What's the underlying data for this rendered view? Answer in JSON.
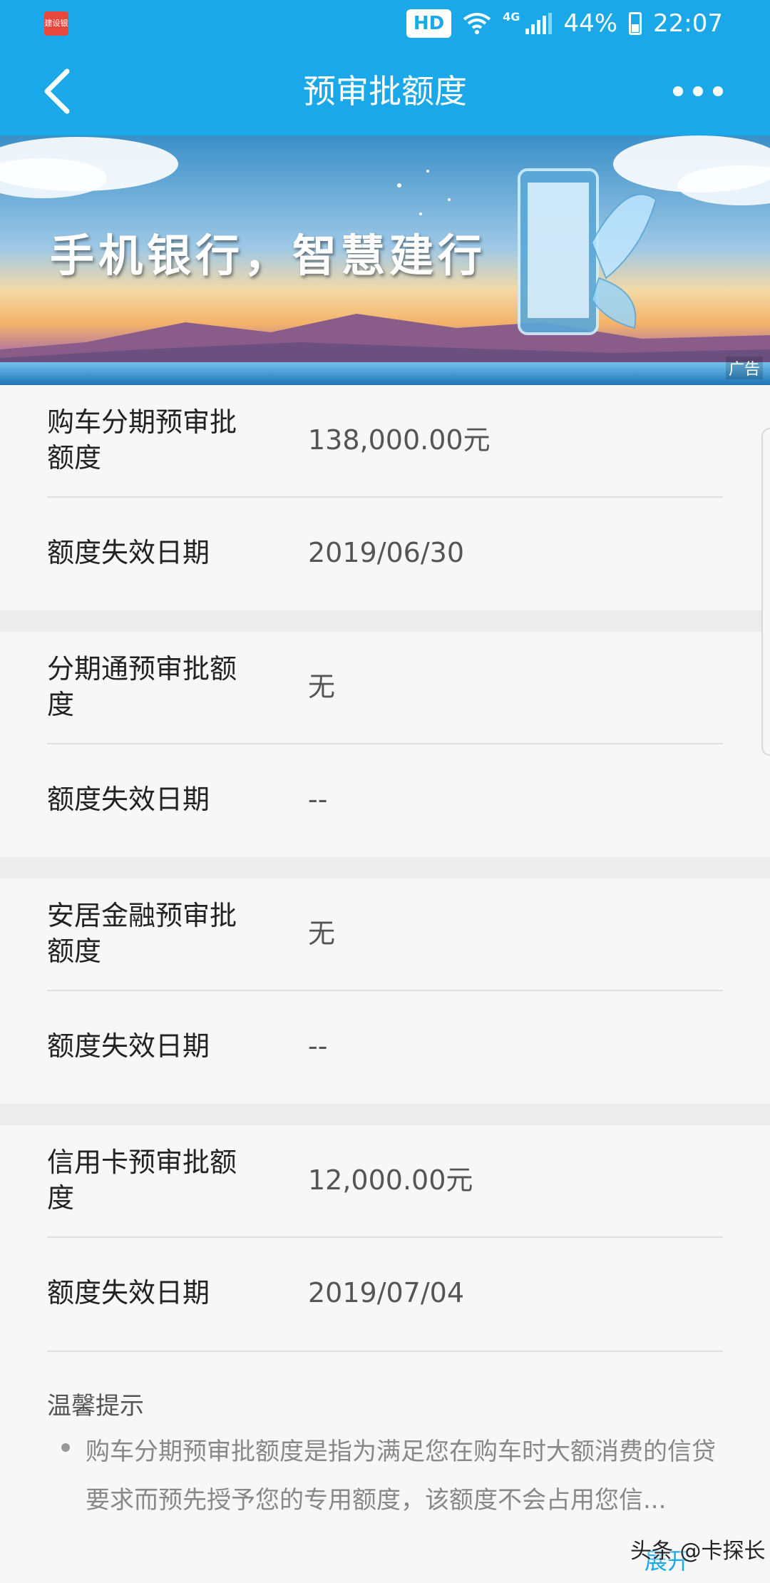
{
  "status_bar": {
    "app_badge": "建设银行",
    "hd": "HD",
    "network": "4G",
    "battery": "44%",
    "time": "22:07"
  },
  "nav": {
    "title": "预审批额度",
    "back_icon": "chevron-left-icon",
    "more_icon": "more-dots-icon"
  },
  "banner": {
    "text": "手机银行，智慧建行",
    "ad_label": "广告"
  },
  "groups": [
    {
      "rows": [
        {
          "label": "购车分期预审批额度",
          "value": "138,000.00元"
        },
        {
          "label": "额度失效日期",
          "value": "2019/06/30"
        }
      ]
    },
    {
      "rows": [
        {
          "label": "分期通预审批额度",
          "value": "无"
        },
        {
          "label": "额度失效日期",
          "value": "--"
        }
      ]
    },
    {
      "rows": [
        {
          "label": "安居金融预审批额度",
          "value": "无"
        },
        {
          "label": "额度失效日期",
          "value": "--"
        }
      ]
    },
    {
      "rows": [
        {
          "label": "信用卡预审批额度",
          "value": "12,000.00元"
        },
        {
          "label": "额度失效日期",
          "value": "2019/07/04"
        }
      ]
    }
  ],
  "tips": {
    "title": "温馨提示",
    "text": "购车分期预审批额度是指为满足您在购车时大额消费的信贷要求而预先授予您的专用额度，该额度不会占用您信...",
    "expand": "展开"
  },
  "watermark": "头条 @卡探长",
  "colors": {
    "primary": "#1aa8e8",
    "background": "#f4f4f4"
  }
}
